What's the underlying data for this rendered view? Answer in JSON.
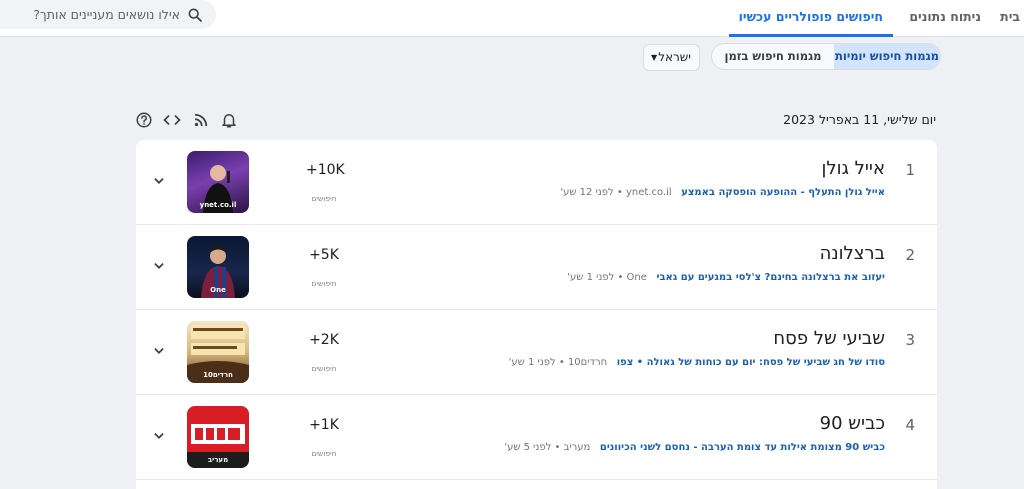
{
  "nav": {
    "tabs": [
      {
        "label": "בית",
        "active": false
      },
      {
        "label": "ניתוח נתונים",
        "active": false
      },
      {
        "label": "חיפושים פופולריים עכשיו",
        "active": true
      }
    ],
    "search_placeholder": "אילו נושאים מעניינים אותך?"
  },
  "toolbar": {
    "daily_label": "מגמות חיפוש יומיות",
    "realtime_label": "מגמות חיפוש בזמן אמת",
    "country": "ישראל"
  },
  "date_label": "יום שלישי, 11 באפריל 2023",
  "tool_icons": [
    "help-icon",
    "embed-icon",
    "rss-icon",
    "notifications-icon"
  ],
  "volume_label": "חיפושים",
  "accent_color": "#1a73e8",
  "trends": [
    {
      "rank": "1",
      "title": "אייל גולן",
      "article": "אייל גולן התעלף - ההופעה הופסקה באמצע",
      "meta": "ynet.co.il • לפני 12 שע'",
      "volume": "+10K",
      "image_caption": "ynet.co.il"
    },
    {
      "rank": "2",
      "title": "ברצלונה",
      "article": "יעזוב את ברצלונה בחינם? צ'לסי במגעים עם גאבי",
      "meta": "One • לפני 1 שע'",
      "volume": "+5K",
      "image_caption": "One"
    },
    {
      "rank": "3",
      "title": "שביעי של פסח",
      "article": "סודו של חג שביעי של פסח: יום עם כוחות של גאולה • צפו",
      "meta": "חרדים10 • לפני 1 שע'",
      "volume": "+2K",
      "image_caption": "חרדים10"
    },
    {
      "rank": "4",
      "title": "כביש 90",
      "article": "כביש 90 מצומת אילות עד צומת הערבה - נחסם לשני הכיוונים",
      "meta": "מעריב • לפני 5 שע'",
      "volume": "+1K",
      "image_caption": "מעריב"
    }
  ]
}
